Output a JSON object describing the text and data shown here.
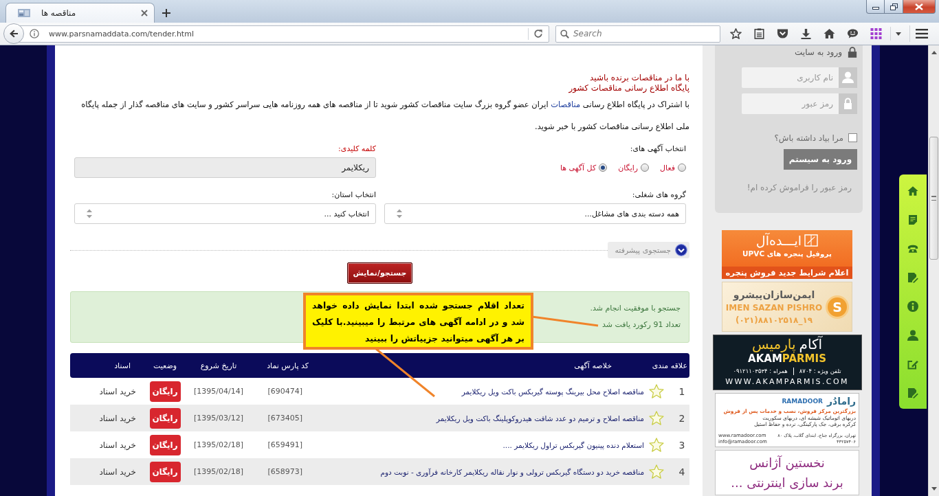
{
  "browser": {
    "tab_title": "مناقصه ها",
    "url": "www.parsnamaddata.com/tender.html",
    "search": {
      "placeholder": "Search"
    }
  },
  "intro": {
    "headings": [
      "با ما در مناقصات برنده باشید",
      "پایگاه اطلاع رسانی مناقصات کشور"
    ],
    "paragraph": {
      "before": "با اشتراک در پایگاه اطلاع رسانی ",
      "link": "مناقصات",
      "after": " ایران عضو گروه بزرگ سایت مناقصات کشور شوید تا از مناقصه های همه روزنامه هایی سراسر کشور و سایت های مناقصه گذار از جمله پایگاه ملی اطلاع رسانی مناقصات کشور با خبر شوید."
    }
  },
  "filters": {
    "ad_type": {
      "label": "انتخاب آگهی های:",
      "options": [
        {
          "label": "فعال",
          "selected": false
        },
        {
          "label": "رایگان",
          "selected": false
        },
        {
          "label": "کل آگهی ها",
          "selected": true
        }
      ]
    },
    "keyword": {
      "label": "کلمه کلیدی:",
      "value": "ریکلایمر"
    },
    "job_group": {
      "label": "گروه های شغلی:",
      "value": "همه دسته بندی های مشاغل..."
    },
    "province": {
      "label": "انتخاب استان:",
      "value": "انتخاب کنید ..."
    },
    "advanced": {
      "label": "جستجوی پیشرفته",
      "expanded": false
    },
    "submit": "جستجو/نمایش"
  },
  "result": {
    "message": "جستجو با موفقیت انجام شد.",
    "count": "تعداد 91 رکورد یافت شد"
  },
  "callout": {
    "text": "تعداد اقلام جستجو شده ابتدا نمایش داده خواهد شد و در ادامه آگهی های مرتبط را میبینید.با کلیک بر هر آگهی میتوانید جزییاتش را ببینید"
  },
  "table": {
    "columns": [
      "علاقه مندی",
      "خلاصه آگهی",
      "کد پارس نماد",
      "تاریخ شروع",
      "وضعیت",
      "اسناد"
    ],
    "rows": [
      {
        "number": "1",
        "favorite": false,
        "title": "مناقصه اصلاح محل بیرینگ پوسته گیربکس باکت ویل ریکلایمر",
        "code": "[690474]",
        "start_date": "[1395/04/14]",
        "status": "رایگان",
        "documents": "خرید اسناد"
      },
      {
        "number": "2",
        "favorite": false,
        "title": "مناقصه اصلاح و ترمیم دو عدد شافت هیدروکوپلینگ باکت ویل ریکلایمر",
        "code": "[673405]",
        "start_date": "[1395/03/12]",
        "status": "رایگان",
        "documents": "خرید اسناد"
      },
      {
        "number": "3",
        "favorite": false,
        "title": "استعلام دنده پینیون گیربکس تراول ریکلایمر ....",
        "code": "[659491]",
        "start_date": "[1395/02/18]",
        "status": "رایگان",
        "documents": "خرید اسناد"
      },
      {
        "number": "4",
        "favorite": false,
        "title": "مناقصه خرید دو دستگاه گیربکس ترولی و نوار نقاله ریکلایمر کارخانه فرآوری - نوبت دوم",
        "code": "[658973]",
        "start_date": "[1395/02/18]",
        "status": "رایگان",
        "documents": "خرید اسناد"
      }
    ]
  },
  "sidebar": {
    "login": {
      "title": "ورود به سایت",
      "username": {
        "placeholder": "نام کاربری"
      },
      "password": {
        "placeholder": "رمز عبور"
      },
      "remember": {
        "label": "مرا بیاد داشته باش؟",
        "checked": false
      },
      "submit": "ورود به سیستم",
      "forgot": "رمز عبور را فراموش کرده ام!"
    },
    "ads": [
      {
        "kind": "orange",
        "brand": "ایـــده‌آل",
        "lines": [
          "پروفیل پنجره های UPVC"
        ],
        "slogan": "اعلام شرایط جدید فروش پنجره"
      },
      {
        "kind": "cream",
        "logo": "S",
        "brand": "ایمن‌سازان‌پیشرو",
        "latin": "IMEN SAZAN PISHRO",
        "phone": "(۰۲۱)۸۸۱۰۲۵۱۸_۱۹"
      },
      {
        "kind": "dark",
        "brand": [
          "آکام",
          "پارمیس"
        ],
        "latin": "AKAM**PARMIS**",
        "phones": [
          "تلفن ویژه : ۸۷۰۴",
          "همراه : ۰۹۱۲۱۱۰۳۵۳۴"
        ],
        "site": "WWW.AKAMPARMIS.COM"
      },
      {
        "kind": "light",
        "brand": "رامادُر",
        "latin": "RAMADOOR",
        "lines": [
          "بزرگترین مرکز فروش، نصب و خدمات پس از فروش",
          "دربهای اتوماتیک شیشه ای، دربهای سکوریت",
          "کرکره برقی، جک پارکینگی، نرده و حفاظ استیل"
        ],
        "contacts": [
          "www.ramadoor.com",
          "info@ramadoor.com"
        ],
        "address": [
          "تهران، بزرگراه جناح، ابتدای گلاب، پلاک ۸۰",
          "۴۴۲۵۷۴۰۶"
        ]
      },
      {
        "kind": "plain",
        "lines": [
          "نخستین آژانس",
          "برند سازی اینترنتی ..."
        ]
      }
    ]
  }
}
